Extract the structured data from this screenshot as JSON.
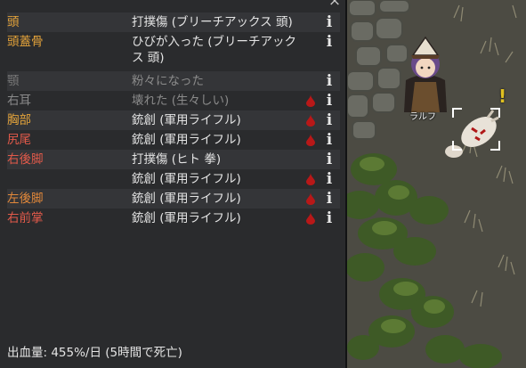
{
  "health_panel": {
    "close_glyph": "×",
    "rows": [
      {
        "part": "頭",
        "part_color": "#e2a23a",
        "injury": "打撲傷 (ブリーチアックス 頭)",
        "bleeding": false,
        "dim": false
      },
      {
        "part": "頭蓋骨",
        "part_color": "#e2a23a",
        "injury": "ひびが入った (ブリーチアックス 頭)",
        "bleeding": false,
        "dim": false
      },
      {
        "part": "顎",
        "part_color": "#777777",
        "injury": "粉々になった",
        "bleeding": false,
        "dim": true
      },
      {
        "part": "右耳",
        "part_color": "#8a8a8a",
        "injury": "壊れた (生々しい)",
        "bleeding": true,
        "dim": true
      },
      {
        "part": "胸部",
        "part_color": "#e2a23a",
        "injury": "銃創 (軍用ライフル)",
        "bleeding": true,
        "dim": false
      },
      {
        "part": "尻尾",
        "part_color": "#e25a4a",
        "injury": "銃創 (軍用ライフル)",
        "bleeding": true,
        "dim": false
      },
      {
        "part": "右後脚",
        "part_color": "#e25a4a",
        "injury": "打撲傷 (ヒト 拳)",
        "bleeding": false,
        "dim": false
      },
      {
        "part": "",
        "part_color": "#e25a4a",
        "injury": "銃創 (軍用ライフル)",
        "bleeding": true,
        "dim": false
      },
      {
        "part": "左後脚",
        "part_color": "#e2883a",
        "injury": "銃創 (軍用ライフル)",
        "bleeding": true,
        "dim": false
      },
      {
        "part": "右前掌",
        "part_color": "#e25a4a",
        "injury": "銃創 (軍用ライフル)",
        "bleeding": true,
        "dim": false
      }
    ],
    "info_glyph": "i",
    "bleed_summary": "出血量: 455%/日 (5時間で死亡)"
  },
  "map": {
    "pawn_name": "ラルフ",
    "alert_glyph": "!"
  },
  "colors": {
    "panel_bg": "#2a2b2d",
    "row_alt_bg": "#343538",
    "blood": "#b81818",
    "text": "#e4e4e4"
  }
}
